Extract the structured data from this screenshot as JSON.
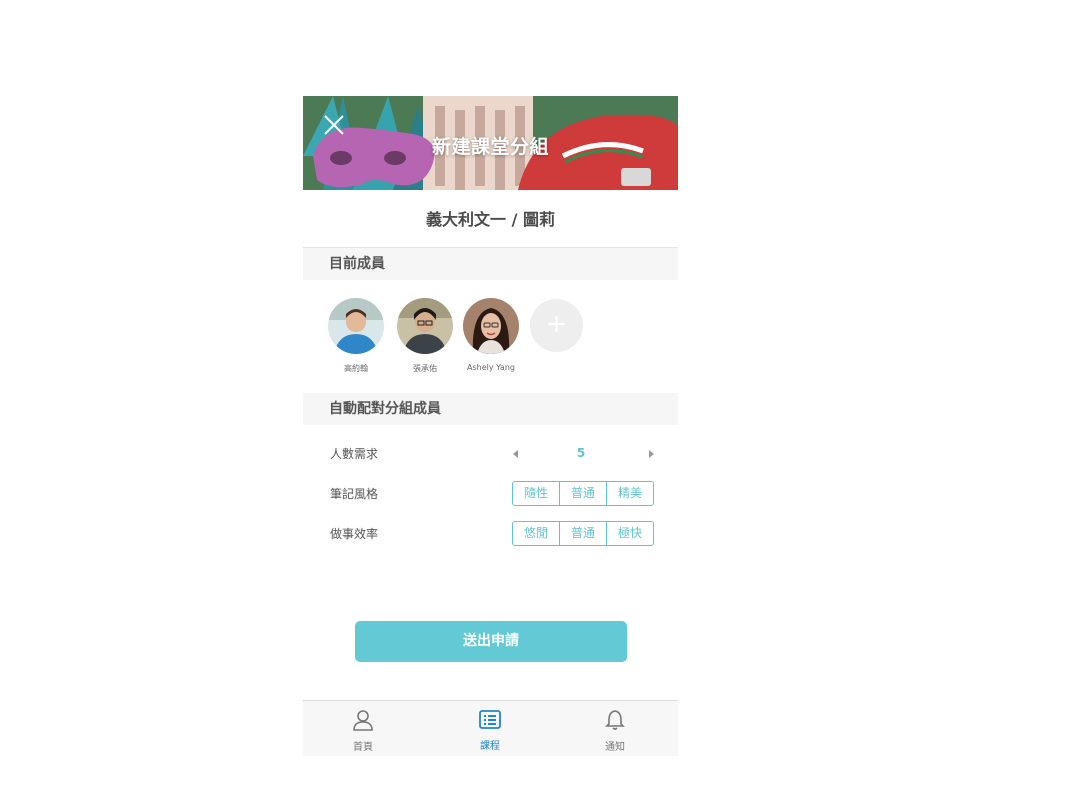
{
  "header": {
    "title": "新建課堂分組"
  },
  "course": {
    "title": "義大利文一 / 圖莉"
  },
  "members_section": {
    "title": "目前成員",
    "members": [
      {
        "name": "高約翰"
      },
      {
        "name": "張承佑"
      },
      {
        "name": "Ashely Yang"
      }
    ],
    "add_symbol": "+"
  },
  "auto_section": {
    "title": "自動配對分組成員",
    "headcount": {
      "label": "人數需求",
      "value": "5"
    },
    "note_style": {
      "label": "筆記風格",
      "options": [
        "隨性",
        "普通",
        "精美"
      ]
    },
    "efficiency": {
      "label": "做事效率",
      "options": [
        "悠閒",
        "普通",
        "極快"
      ]
    }
  },
  "submit": {
    "label": "送出申請"
  },
  "tabbar": {
    "items": [
      {
        "label": "首頁",
        "icon": "user-icon",
        "active": false
      },
      {
        "label": "課程",
        "icon": "list-icon",
        "active": true
      },
      {
        "label": "通知",
        "icon": "bell-icon",
        "active": false
      }
    ]
  },
  "colors": {
    "accent": "#63c9d4",
    "active_tab": "#1e88c9"
  }
}
